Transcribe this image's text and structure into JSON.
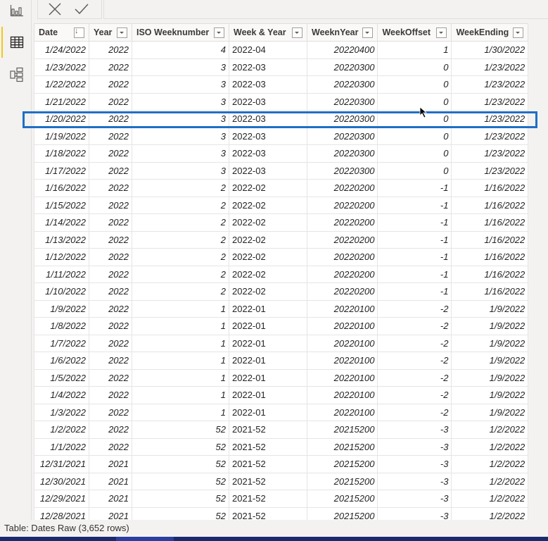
{
  "left_rail": {
    "items": [
      {
        "name": "report-view",
        "icon": "bar-chart-icon",
        "active": false
      },
      {
        "name": "data-view",
        "icon": "table-grid-icon",
        "active": true
      },
      {
        "name": "model-view",
        "icon": "model-diagram-icon",
        "active": false
      }
    ],
    "active_color": "#f2c811"
  },
  "formula_bar": {
    "cancel_icon": "close-icon",
    "commit_icon": "checkmark-icon"
  },
  "table": {
    "columns": [
      {
        "label": "Date",
        "filter": "sort-descending-icon"
      },
      {
        "label": "Year",
        "filter": "dropdown-icon"
      },
      {
        "label": "ISO Weeknumber",
        "filter": "dropdown-icon"
      },
      {
        "label": "Week & Year",
        "filter": "dropdown-icon"
      },
      {
        "label": "WeeknYear",
        "filter": "dropdown-icon"
      },
      {
        "label": "WeekOffset",
        "filter": "dropdown-icon"
      },
      {
        "label": "WeekEnding",
        "filter": "dropdown-icon"
      }
    ],
    "rows": [
      [
        "1/24/2022",
        "2022",
        "4",
        "2022-04",
        "20220400",
        "1",
        "1/30/2022"
      ],
      [
        "1/23/2022",
        "2022",
        "3",
        "2022-03",
        "20220300",
        "0",
        "1/23/2022"
      ],
      [
        "1/22/2022",
        "2022",
        "3",
        "2022-03",
        "20220300",
        "0",
        "1/23/2022"
      ],
      [
        "1/21/2022",
        "2022",
        "3",
        "2022-03",
        "20220300",
        "0",
        "1/23/2022"
      ],
      [
        "1/20/2022",
        "2022",
        "3",
        "2022-03",
        "20220300",
        "0",
        "1/23/2022"
      ],
      [
        "1/19/2022",
        "2022",
        "3",
        "2022-03",
        "20220300",
        "0",
        "1/23/2022"
      ],
      [
        "1/18/2022",
        "2022",
        "3",
        "2022-03",
        "20220300",
        "0",
        "1/23/2022"
      ],
      [
        "1/17/2022",
        "2022",
        "3",
        "2022-03",
        "20220300",
        "0",
        "1/23/2022"
      ],
      [
        "1/16/2022",
        "2022",
        "2",
        "2022-02",
        "20220200",
        "-1",
        "1/16/2022"
      ],
      [
        "1/15/2022",
        "2022",
        "2",
        "2022-02",
        "20220200",
        "-1",
        "1/16/2022"
      ],
      [
        "1/14/2022",
        "2022",
        "2",
        "2022-02",
        "20220200",
        "-1",
        "1/16/2022"
      ],
      [
        "1/13/2022",
        "2022",
        "2",
        "2022-02",
        "20220200",
        "-1",
        "1/16/2022"
      ],
      [
        "1/12/2022",
        "2022",
        "2",
        "2022-02",
        "20220200",
        "-1",
        "1/16/2022"
      ],
      [
        "1/11/2022",
        "2022",
        "2",
        "2022-02",
        "20220200",
        "-1",
        "1/16/2022"
      ],
      [
        "1/10/2022",
        "2022",
        "2",
        "2022-02",
        "20220200",
        "-1",
        "1/16/2022"
      ],
      [
        "1/9/2022",
        "2022",
        "1",
        "2022-01",
        "20220100",
        "-2",
        "1/9/2022"
      ],
      [
        "1/8/2022",
        "2022",
        "1",
        "2022-01",
        "20220100",
        "-2",
        "1/9/2022"
      ],
      [
        "1/7/2022",
        "2022",
        "1",
        "2022-01",
        "20220100",
        "-2",
        "1/9/2022"
      ],
      [
        "1/6/2022",
        "2022",
        "1",
        "2022-01",
        "20220100",
        "-2",
        "1/9/2022"
      ],
      [
        "1/5/2022",
        "2022",
        "1",
        "2022-01",
        "20220100",
        "-2",
        "1/9/2022"
      ],
      [
        "1/4/2022",
        "2022",
        "1",
        "2022-01",
        "20220100",
        "-2",
        "1/9/2022"
      ],
      [
        "1/3/2022",
        "2022",
        "1",
        "2022-01",
        "20220100",
        "-2",
        "1/9/2022"
      ],
      [
        "1/2/2022",
        "2022",
        "52",
        "2021-52",
        "20215200",
        "-3",
        "1/2/2022"
      ],
      [
        "1/1/2022",
        "2022",
        "52",
        "2021-52",
        "20215200",
        "-3",
        "1/2/2022"
      ],
      [
        "12/31/2021",
        "2021",
        "52",
        "2021-52",
        "20215200",
        "-3",
        "1/2/2022"
      ],
      [
        "12/30/2021",
        "2021",
        "52",
        "2021-52",
        "20215200",
        "-3",
        "1/2/2022"
      ],
      [
        "12/29/2021",
        "2021",
        "52",
        "2021-52",
        "20215200",
        "-3",
        "1/2/2022"
      ],
      [
        "12/28/2021",
        "2021",
        "52",
        "2021-52",
        "20215200",
        "-3",
        "1/2/2022"
      ]
    ],
    "highlighted_row_index": 4,
    "highlight_color": "#1f6fc5"
  },
  "status_bar": {
    "text": "Table: Dates Raw (3,652 rows)"
  }
}
